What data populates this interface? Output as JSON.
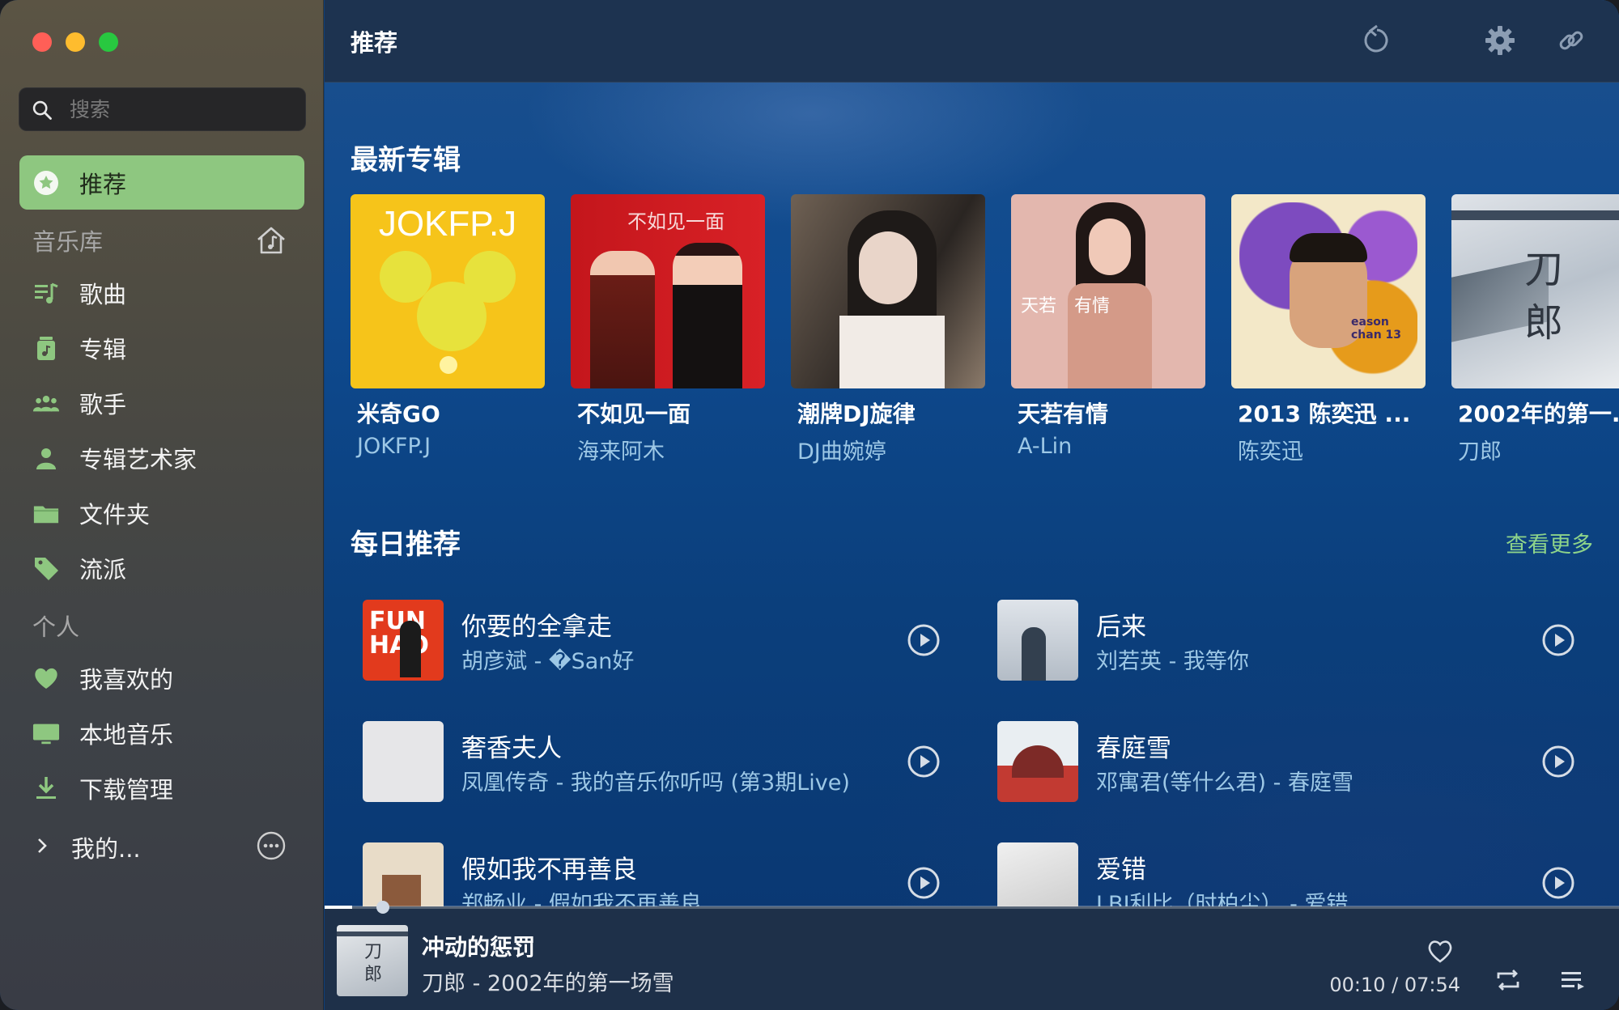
{
  "sidebar": {
    "search_placeholder": "搜索",
    "active_item": "推荐",
    "library_label": "音乐库",
    "library_items": [
      "歌曲",
      "专辑",
      "歌手",
      "专辑艺术家",
      "文件夹",
      "流派"
    ],
    "personal_label": "个人",
    "personal_items": [
      "我喜欢的",
      "本地音乐",
      "下载管理"
    ],
    "mine_label": "我的...",
    "accent": "#8ec780"
  },
  "header": {
    "title": "推荐"
  },
  "new_albums": {
    "title": "最新专辑",
    "items": [
      {
        "title": "米奇GO",
        "artist": "JOKFP.J",
        "cover_text": "JOKFP.J"
      },
      {
        "title": "不如见一面",
        "artist": "海来阿木",
        "cover_text": "不如见一面"
      },
      {
        "title": "潮牌DJ旋律",
        "artist": "DJ曲婉婷",
        "cover_text": ""
      },
      {
        "title": "天若有情",
        "artist": "A-Lin",
        "cover_text": "天若　有情"
      },
      {
        "title": "2013 陈奕迅 ...",
        "artist": "陈奕迅",
        "cover_text": "eason chan 13"
      },
      {
        "title": "2002年的第一...",
        "artist": "刀郎",
        "cover_text": "刀 郎"
      }
    ]
  },
  "daily": {
    "title": "每日推荐",
    "see_more": "查看更多",
    "songs": [
      {
        "title": "你要的全拿走",
        "sub": "胡彦斌 - �San好"
      },
      {
        "title": "后来",
        "sub": "刘若英 - 我等你"
      },
      {
        "title": "奢香夫人",
        "sub": "凤凰传奇 - 我的音乐你听吗 (第3期Live)"
      },
      {
        "title": "春庭雪",
        "sub": "邓寓君(等什么君) - 春庭雪"
      },
      {
        "title": "假如我不再善良",
        "sub": "郑畅业 - 假如我不再善良"
      },
      {
        "title": "爱错",
        "sub": "LBI利比（时柏尘） - 爱错"
      }
    ]
  },
  "player": {
    "title": "冲动的惩罚",
    "sub": "刀郎 - 2002年的第一场雪",
    "time": "00:10 / 07:54",
    "progress": 0.021
  }
}
